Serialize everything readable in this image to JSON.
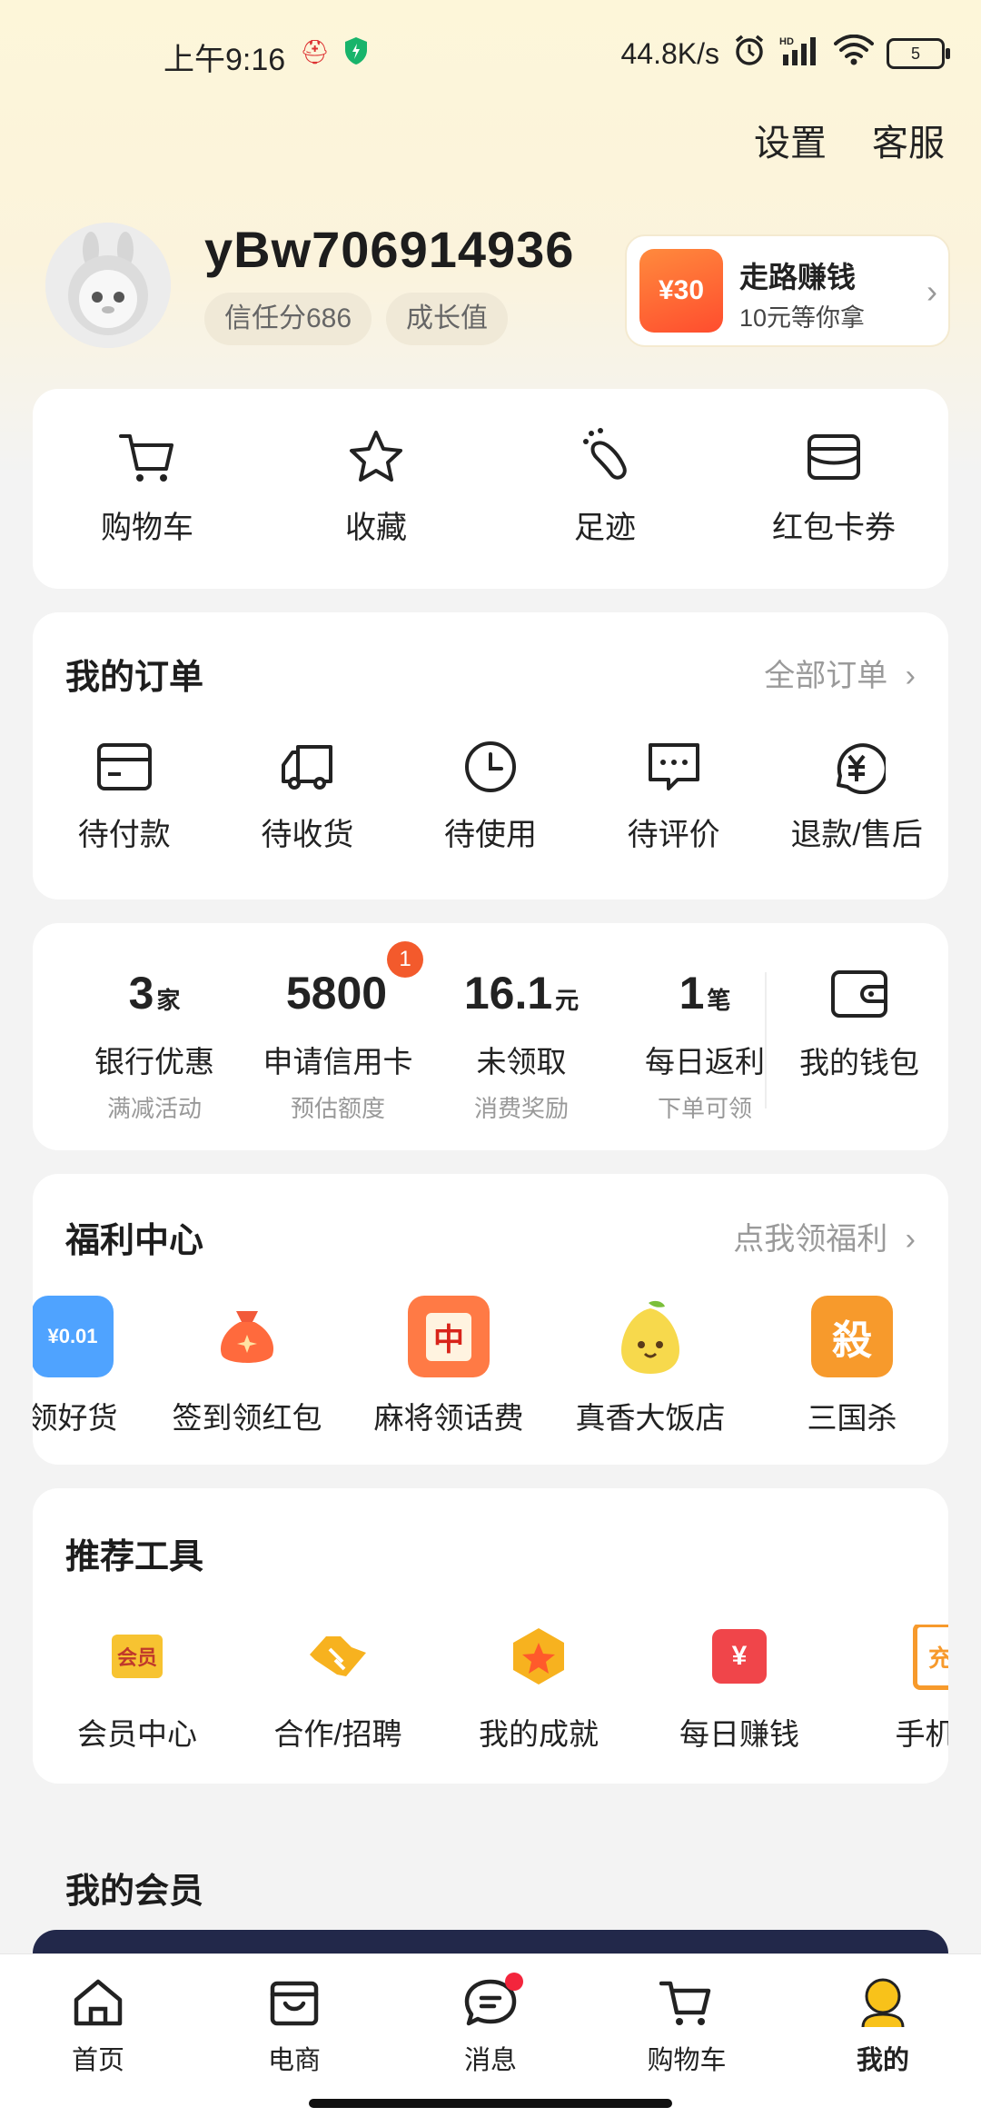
{
  "status_bar": {
    "time": "上午9:16",
    "network_speed": "44.8K/s",
    "battery": "5"
  },
  "top_links": {
    "settings": "设置",
    "service": "客服"
  },
  "profile": {
    "username": "yBw706914936",
    "trust_score": "信任分686",
    "growth": "成长值"
  },
  "promo": {
    "badge": "¥30",
    "title": "走路赚钱",
    "subtitle": "10元等你拿"
  },
  "quick_actions": [
    {
      "label": "购物车",
      "icon": "cart-icon"
    },
    {
      "label": "收藏",
      "icon": "star-icon"
    },
    {
      "label": "足迹",
      "icon": "footprint-icon"
    },
    {
      "label": "红包卡券",
      "icon": "wallet-card-icon"
    }
  ],
  "orders": {
    "title": "我的订单",
    "all_link": "全部订单",
    "items": [
      {
        "label": "待付款",
        "icon": "card-icon"
      },
      {
        "label": "待收货",
        "icon": "truck-icon"
      },
      {
        "label": "待使用",
        "icon": "clock-icon"
      },
      {
        "label": "待评价",
        "icon": "comment-icon"
      },
      {
        "label": "退款/售后",
        "icon": "refund-icon"
      }
    ]
  },
  "finance": {
    "stats": [
      {
        "value": "3",
        "unit": "家",
        "label": "银行优惠",
        "sub": "满减活动"
      },
      {
        "value": "5800",
        "unit": "",
        "label": "申请信用卡",
        "sub": "预估额度",
        "badge": "1"
      },
      {
        "value": "16.1",
        "unit": "元",
        "label": "未领取",
        "sub": "消费奖励"
      },
      {
        "value": "1",
        "unit": "笔",
        "label": "每日返利",
        "sub": "下单可领"
      }
    ],
    "wallet_label": "我的钱包"
  },
  "welfare": {
    "title": "福利中心",
    "link": "点我领福利",
    "items": [
      {
        "label": "领好货",
        "icon_text": "¥0.01",
        "icon": "goods-icon",
        "color": "#4fa3ff"
      },
      {
        "label": "签到领红包",
        "icon_text": "",
        "icon": "money-bag-icon",
        "color": "#ff6a3d"
      },
      {
        "label": "麻将领话费",
        "icon_text": "中",
        "icon": "mahjong-icon",
        "color": "#ff7a45"
      },
      {
        "label": "真香大饭店",
        "icon_text": "",
        "icon": "pear-mascot-icon",
        "color": "#f7d94c"
      },
      {
        "label": "三国杀",
        "icon_text": "殺",
        "icon": "sanguosha-icon",
        "color": "#f79a2c"
      }
    ]
  },
  "tools": {
    "title": "推荐工具",
    "items": [
      {
        "label": "会员中心",
        "icon_text": "会员",
        "icon": "vip-icon",
        "color": "#f7c331"
      },
      {
        "label": "合作/招聘",
        "icon_text": "",
        "icon": "handshake-icon",
        "color": "#f7b21f"
      },
      {
        "label": "我的成就",
        "icon_text": "",
        "icon": "achievement-icon",
        "color": "#f7b21f"
      },
      {
        "label": "每日赚钱",
        "icon_text": "¥",
        "icon": "calendar-money-icon",
        "color": "#f0454a"
      },
      {
        "label": "手机充",
        "icon_text": "充",
        "icon": "phone-recharge-icon",
        "color": "#f79a2c"
      }
    ]
  },
  "member": {
    "title": "我的会员"
  },
  "bottom_nav": [
    {
      "label": "首页",
      "icon": "home-icon"
    },
    {
      "label": "电商",
      "icon": "shop-icon"
    },
    {
      "label": "消息",
      "icon": "message-icon"
    },
    {
      "label": "购物车",
      "icon": "cart-icon"
    },
    {
      "label": "我的",
      "icon": "profile-icon",
      "active": true
    }
  ]
}
